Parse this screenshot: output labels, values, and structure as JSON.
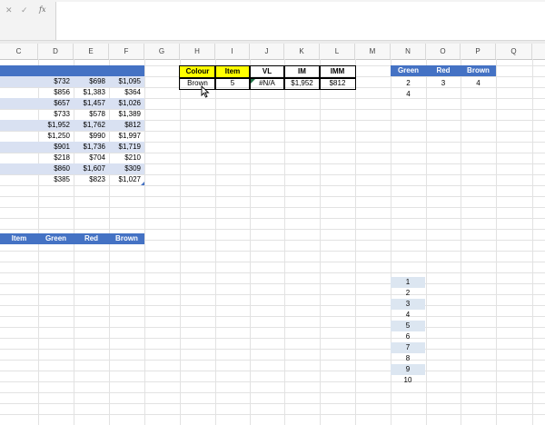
{
  "formula_bar": {
    "cancel": "✕",
    "enter": "✓",
    "fx": "fx",
    "value": ""
  },
  "columns": [
    "C",
    "D",
    "E",
    "F",
    "G",
    "H",
    "I",
    "J",
    "K",
    "L",
    "M",
    "N",
    "O",
    "P",
    "Q"
  ],
  "colors": {
    "header_blue": "#4472c4",
    "band": "#d9e1f2",
    "yellow": "#ffff00",
    "index_fill": "#dce6f1"
  },
  "data_table": {
    "rows": [
      [
        "$732",
        "$698",
        "$1,095"
      ],
      [
        "$856",
        "$1,383",
        "$364"
      ],
      [
        "$657",
        "$1,457",
        "$1,026"
      ],
      [
        "$733",
        "$578",
        "$1,389"
      ],
      [
        "$1,952",
        "$1,762",
        "$812"
      ],
      [
        "$1,250",
        "$990",
        "$1,997"
      ],
      [
        "$901",
        "$1,736",
        "$1,719"
      ],
      [
        "$218",
        "$704",
        "$210"
      ],
      [
        "$860",
        "$1,607",
        "$309"
      ],
      [
        "$385",
        "$823",
        "$1,027"
      ]
    ]
  },
  "lookup": {
    "headers": [
      "Colour",
      "Item",
      "VL",
      "IM",
      "IMM"
    ],
    "values": [
      "Brown",
      "5",
      "#N/A",
      "$1,952",
      "$812"
    ]
  },
  "count_table": {
    "headers": [
      "Green",
      "Red",
      "Brown"
    ],
    "row1": [
      "2",
      "3",
      "4"
    ],
    "row2": [
      "4"
    ]
  },
  "summary_table": {
    "headers": [
      "Item",
      "Green",
      "Red",
      "Brown"
    ]
  },
  "index_list": [
    "1",
    "2",
    "3",
    "4",
    "5",
    "6",
    "7",
    "8",
    "9",
    "10"
  ]
}
